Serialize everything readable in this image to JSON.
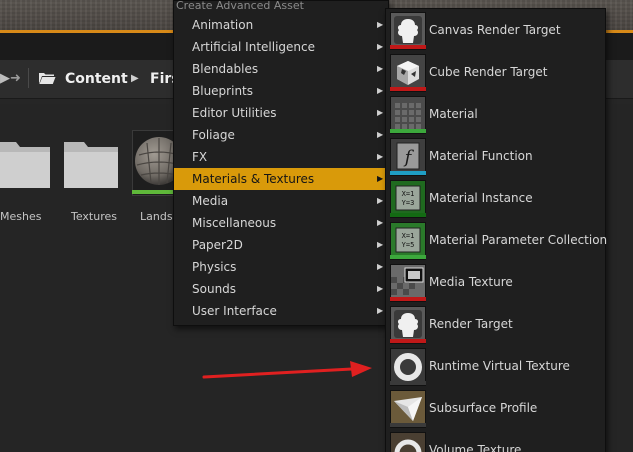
{
  "breadcrumb": {
    "root": "Content",
    "child": "Firs"
  },
  "assets": [
    {
      "label": "Meshes"
    },
    {
      "label": "Textures"
    },
    {
      "label": "Landsc"
    }
  ],
  "menu": {
    "header": "Create Advanced Asset",
    "items": [
      {
        "label": "Animation"
      },
      {
        "label": "Artificial Intelligence"
      },
      {
        "label": "Blendables"
      },
      {
        "label": "Blueprints"
      },
      {
        "label": "Editor Utilities"
      },
      {
        "label": "Foliage"
      },
      {
        "label": "FX"
      },
      {
        "label": "Materials & Textures"
      },
      {
        "label": "Media"
      },
      {
        "label": "Miscellaneous"
      },
      {
        "label": "Paper2D"
      },
      {
        "label": "Physics"
      },
      {
        "label": "Sounds"
      },
      {
        "label": "User Interface"
      }
    ],
    "active_item": "Materials & Textures",
    "accent_color": "#d99a0a"
  },
  "submenu": {
    "items": [
      {
        "label": "Canvas Render Target",
        "icon": "render-target-icon",
        "accent": "#c01818"
      },
      {
        "label": "Cube Render Target",
        "icon": "cube-render-target-icon",
        "accent": "#c01818"
      },
      {
        "label": "Material",
        "icon": "material-icon",
        "accent": "#3ca83c"
      },
      {
        "label": "Material Function",
        "icon": "material-function-icon",
        "accent": "#1f9ec4"
      },
      {
        "label": "Material Instance",
        "icon": "material-instance-icon",
        "accent": "#136a13"
      },
      {
        "label": "Material Parameter Collection",
        "icon": "material-parameter-collection-icon",
        "accent": "#3ca83c"
      },
      {
        "label": "Media Texture",
        "icon": "media-texture-icon",
        "accent": "#c01818"
      },
      {
        "label": "Render Target",
        "icon": "render-target-icon",
        "accent": "#c01818"
      },
      {
        "label": "Runtime Virtual Texture",
        "icon": "runtime-virtual-texture-icon",
        "accent": "#3a3a3a"
      },
      {
        "label": "Subsurface Profile",
        "icon": "subsurface-profile-icon",
        "accent": "#3a3a3a"
      },
      {
        "label": "Volume Texture",
        "icon": "volume-texture-icon",
        "accent": "#3a3a3a"
      }
    ]
  },
  "annotation": {
    "arrow_color": "#e02020"
  }
}
